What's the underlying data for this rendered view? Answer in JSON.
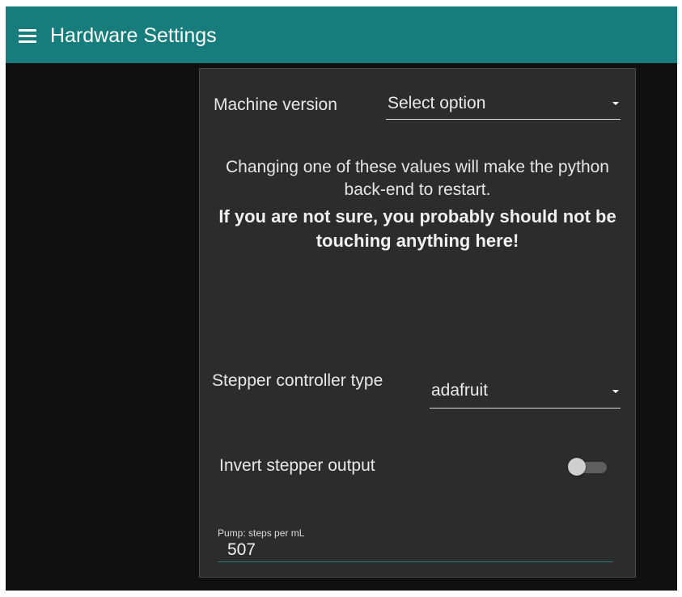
{
  "app_bar": {
    "title": "Hardware Settings",
    "menu_icon": "hamburger-menu-icon",
    "background": "#167c7c"
  },
  "settings": {
    "machine_version": {
      "label": "Machine version",
      "value": "Select option"
    },
    "warning": {
      "text": "Changing one of these values will make the python back-end to restart.",
      "emphasis": "If you are not sure, you probably should not be touching anything here!"
    },
    "stepper_controller_type": {
      "label": "Stepper controller type",
      "value": "adafruit"
    },
    "invert_stepper_output": {
      "label": "Invert stepper output",
      "enabled": false
    },
    "pump_steps_per_ml": {
      "label": "Pump: steps per mL",
      "value": "507"
    }
  },
  "colors": {
    "page_background": "#101010",
    "panel_background": "#2c2c2c",
    "input_underline": "#2a7a7a"
  }
}
